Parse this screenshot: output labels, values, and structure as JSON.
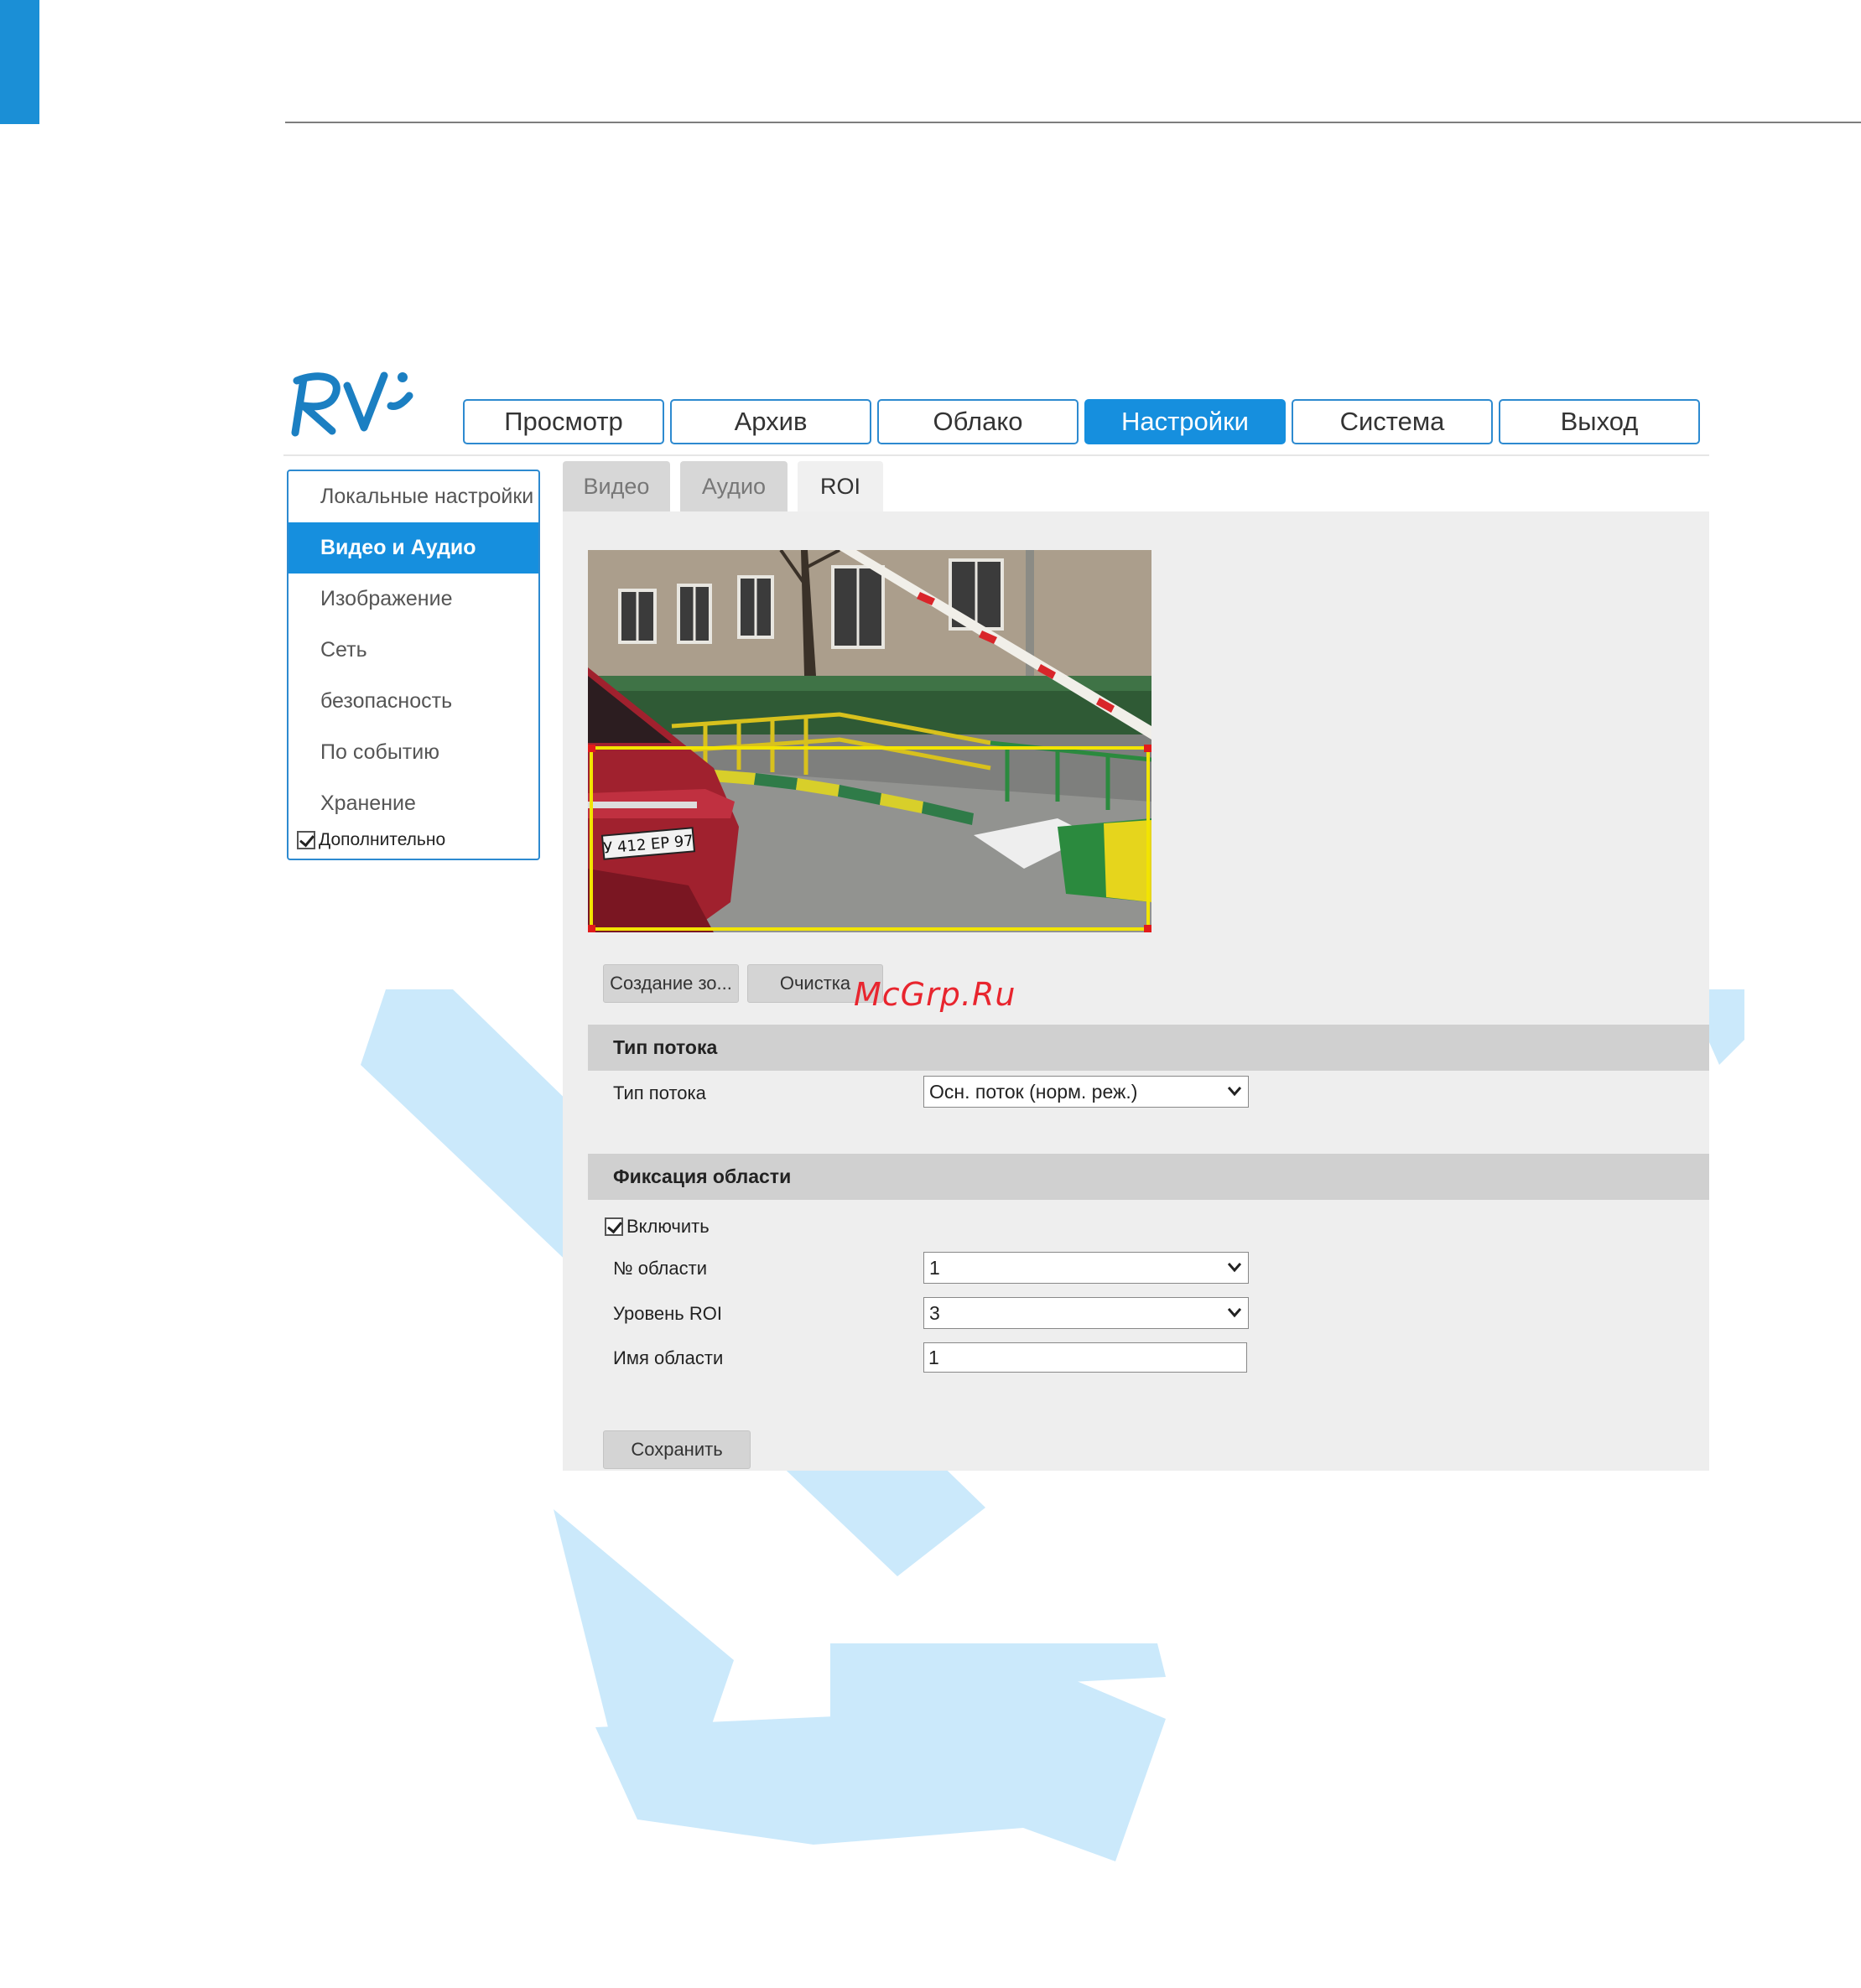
{
  "brand": {
    "logo_text": "RVi",
    "logo_color": "#1b7fc2"
  },
  "topnav": {
    "items": [
      {
        "label": "Просмотр",
        "active": false
      },
      {
        "label": "Архив",
        "active": false
      },
      {
        "label": "Облако",
        "active": false
      },
      {
        "label": "Настройки",
        "active": true
      },
      {
        "label": "Система",
        "active": false
      },
      {
        "label": "Выход",
        "active": false
      }
    ]
  },
  "sidebar": {
    "items": [
      {
        "label": "Локальные настройки",
        "active": false
      },
      {
        "label": "Видео и Аудио",
        "active": true
      },
      {
        "label": "Изображение",
        "active": false
      },
      {
        "label": "Сеть",
        "active": false
      },
      {
        "label": "безопасность",
        "active": false
      },
      {
        "label": "По событию",
        "active": false
      },
      {
        "label": "Хранение",
        "active": false
      }
    ],
    "advanced": {
      "label": "Дополнительно",
      "checked": true
    }
  },
  "tabs": [
    {
      "label": "Видео",
      "active": false
    },
    {
      "label": "Аудио",
      "active": false
    },
    {
      "label": "ROI",
      "active": true
    }
  ],
  "video": {
    "plate_text": "У 412 ЕР 97",
    "roi_color": "#f2e400",
    "handle_color": "#e21b1b"
  },
  "actions": {
    "create_zone_label": "Создание зо...",
    "clear_label": "Очистка",
    "save_label": "Сохранить"
  },
  "stream_section": {
    "title": "Тип потока",
    "stream_type_label": "Тип потока",
    "stream_type_value": "Осн. поток (норм. реж.)"
  },
  "region_section": {
    "title": "Фиксация области",
    "enable_label": "Включить",
    "enable_checked": true,
    "region_no_label": "№ области",
    "region_no_value": "1",
    "roi_level_label": "Уровень ROI",
    "roi_level_value": "3",
    "region_name_label": "Имя области",
    "region_name_value": "1"
  },
  "watermark": {
    "text": "McGrp.Ru"
  },
  "colors": {
    "accent": "#168fde",
    "panel_bg": "#eeeeee",
    "section_bg": "#d0d0d0"
  }
}
